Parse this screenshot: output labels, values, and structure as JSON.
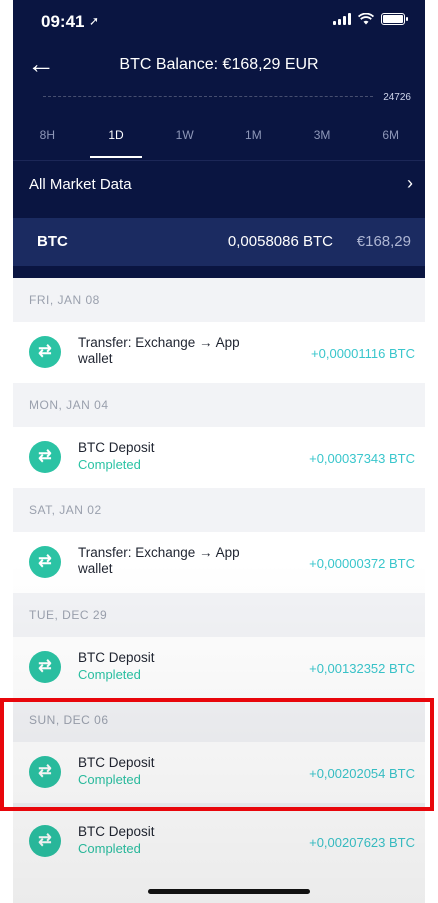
{
  "status_bar": {
    "time": "09:41",
    "location_glyph": "➚"
  },
  "header": {
    "back_glyph": "←",
    "title": "BTC Balance: €168,29 EUR",
    "chart_value": "24726",
    "tabs": [
      "8H",
      "1D",
      "1W",
      "1M",
      "3M",
      "6M"
    ],
    "active_tab": "1D"
  },
  "market": {
    "label": "All Market Data",
    "chevron": "›"
  },
  "asset": {
    "symbol": "BTC",
    "amount": "0,0058086 BTC",
    "fiat": "€168,29"
  },
  "groups": [
    {
      "date": "FRI, JAN 08",
      "tx": {
        "title": "Transfer: Exchange → App wallet",
        "sub": "",
        "amount": "+0,00001116 BTC"
      }
    },
    {
      "date": "MON, JAN 04",
      "tx": {
        "title": "BTC Deposit",
        "sub": "Completed",
        "amount": "+0,00037343 BTC"
      }
    },
    {
      "date": "SAT, JAN 02",
      "tx": {
        "title": "Transfer: Exchange → App wallet",
        "sub": "",
        "amount": "+0,00000372 BTC"
      }
    },
    {
      "date": "TUE, DEC 29",
      "tx": {
        "title": "BTC Deposit",
        "sub": "Completed",
        "amount": "+0,00132352 BTC"
      }
    },
    {
      "date": "SUN, DEC 06",
      "tx": {
        "title": "BTC Deposit",
        "sub": "Completed",
        "amount": "+0,00202054 BTC"
      }
    },
    {
      "date": "",
      "tx": {
        "title": "BTC Deposit",
        "sub": "Completed",
        "amount": "+0,00207623 BTC"
      }
    }
  ],
  "tx_icon_glyph": "⇄",
  "colors": {
    "header_bg": "#0a1541",
    "asset_bar": "#1b2b61",
    "accent": "#2bc3a4",
    "amount": "#39c6cc",
    "highlight": "#e8060b"
  }
}
